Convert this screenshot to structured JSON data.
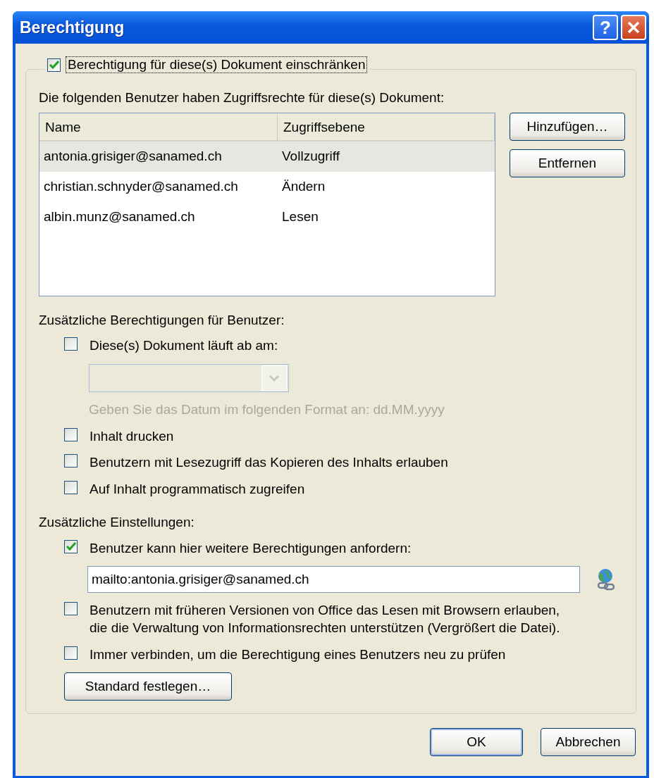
{
  "window": {
    "title": "Berechtigung",
    "help_button": "?"
  },
  "restrict": {
    "label": "Berechtigung für diese(s) Dokument einschränken",
    "checked": true
  },
  "users": {
    "label": "Die folgenden Benutzer haben Zugriffsrechte für diese(s) Dokument:",
    "columns": [
      "Name",
      "Zugriffsebene"
    ],
    "rows": [
      {
        "name": "antonia.grisiger@sanamed.ch",
        "access": "Vollzugriff",
        "selected": true
      },
      {
        "name": "christian.schnyder@sanamed.ch",
        "access": "Ändern",
        "selected": false
      },
      {
        "name": "albin.munz@sanamed.ch",
        "access": "Lesen",
        "selected": false
      }
    ],
    "buttons": [
      "Hinzufügen…",
      "Entfernen"
    ]
  },
  "additional_permissions": {
    "label": "Zusätzliche Berechtigungen für Benutzer:",
    "items": [
      {
        "kind": "checkbox",
        "label": "Diese(s) Dokument läuft ab am:",
        "checked": false
      },
      {
        "kind": "combo",
        "disabled": true
      },
      {
        "kind": "hint",
        "label": "Geben Sie das Datum im folgenden Format an: dd.MM.yyyy"
      },
      {
        "kind": "checkbox",
        "label": "Inhalt drucken",
        "checked": false
      },
      {
        "kind": "checkbox",
        "label": "Benutzern mit Lesezugriff das Kopieren des Inhalts erlauben",
        "checked": false
      },
      {
        "kind": "checkbox",
        "label": "Auf Inhalt programmatisch zugreifen",
        "checked": false
      }
    ]
  },
  "additional_settings": {
    "label": "Zusätzliche Einstellungen:",
    "items": [
      {
        "kind": "checkbox",
        "label": "Benutzer kann hier weitere Berechtigungen anfordern:",
        "checked": true
      },
      {
        "kind": "field",
        "value": "mailto:antonia.grisiger@sanamed.ch"
      },
      {
        "kind": "checkbox",
        "label": "Benutzern mit früheren Versionen von Office das Lesen mit Browsern erlauben, die die Verwaltung von Informationsrechten unterstützen (Vergrößert die Datei).",
        "checked": false
      },
      {
        "kind": "checkbox",
        "label": "Immer verbinden, um die Berechtigung eines Benutzers neu zu prüfen",
        "checked": false
      }
    ],
    "button": "Standard festlegen…"
  },
  "footer_buttons": [
    {
      "label": "OK",
      "default": true
    },
    {
      "label": "Abbrechen",
      "default": false
    }
  ]
}
